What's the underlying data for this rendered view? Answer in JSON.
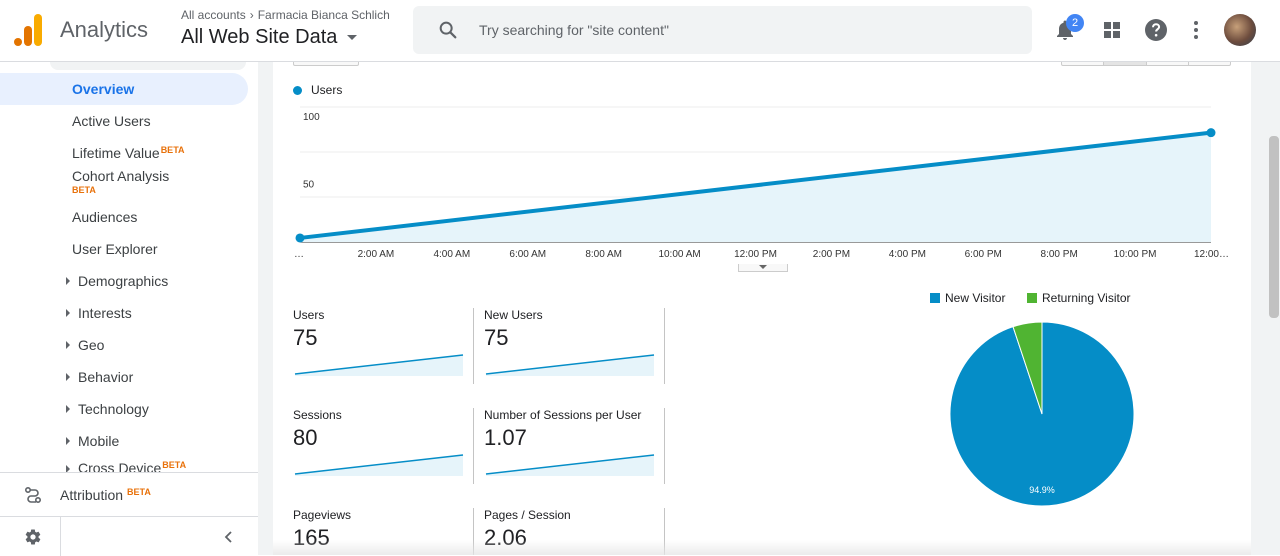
{
  "header": {
    "app_name": "Analytics",
    "breadcrumb_root": "All accounts",
    "breadcrumb_sep": "›",
    "account_name": "Farmacia Bianca Schlich",
    "view_name": "All Web Site Data",
    "search_placeholder": "Try searching for \"site content\"",
    "notification_count": "2"
  },
  "sidebar": {
    "items": [
      {
        "label": "Overview",
        "active": true
      },
      {
        "label": "Active Users"
      },
      {
        "label": "Lifetime Value",
        "badge": "BETA"
      },
      {
        "label": "Cohort Analysis",
        "badge": "BETA"
      },
      {
        "label": "Audiences"
      },
      {
        "label": "User Explorer"
      }
    ],
    "groups": [
      "Demographics",
      "Interests",
      "Geo",
      "Behavior",
      "Technology",
      "Mobile",
      "Cross Device"
    ],
    "cross_device_badge": "BETA",
    "attribution_label": "Attribution",
    "attribution_badge": "BETA"
  },
  "chart_data": [
    {
      "type": "area",
      "series": [
        {
          "name": "Users",
          "values": [
            3,
            81
          ]
        }
      ],
      "x": [
        "…",
        "12:00…"
      ],
      "x_ticks": [
        "…",
        "2:00 AM",
        "4:00 AM",
        "6:00 AM",
        "8:00 AM",
        "10:00 AM",
        "12:00 PM",
        "2:00 PM",
        "4:00 PM",
        "6:00 PM",
        "8:00 PM",
        "10:00 PM",
        "12:00…"
      ],
      "y_ticks": [
        "100",
        "50"
      ],
      "ylim": [
        0,
        100
      ],
      "color": "#058dc7",
      "grid": true,
      "legend": "top-left"
    },
    {
      "type": "pie",
      "labels": [
        "New Visitor",
        "Returning Visitor"
      ],
      "values": [
        94.9,
        5.1
      ],
      "colors": [
        "#058dc7",
        "#50b432"
      ],
      "slice_labels": [
        "94.9%",
        ""
      ],
      "legend": "top"
    }
  ],
  "metrics": [
    {
      "label": "Users",
      "value": "75"
    },
    {
      "label": "New Users",
      "value": "75"
    },
    {
      "label": "Sessions",
      "value": "80"
    },
    {
      "label": "Number of Sessions per User",
      "value": "1.07"
    },
    {
      "label": "Pageviews",
      "value": "165"
    },
    {
      "label": "Pages / Session",
      "value": "2.06"
    }
  ]
}
